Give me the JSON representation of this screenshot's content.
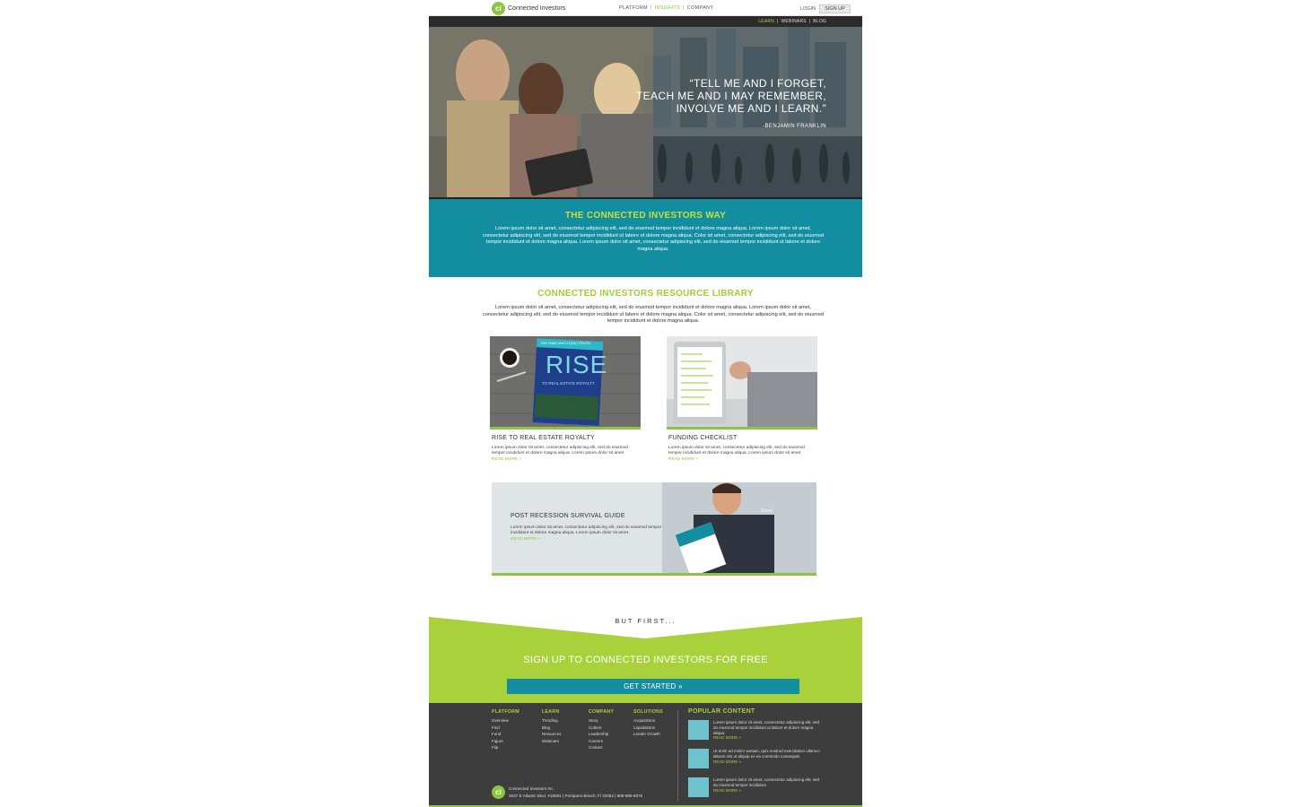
{
  "brand": {
    "name": "Connected Investors",
    "mark": "ci"
  },
  "nav": {
    "items": [
      "PLATFORM",
      "INSIGHTS",
      "COMPANY"
    ],
    "login": "LOGIN",
    "signup": "SIGN UP"
  },
  "subnav": {
    "items": [
      "LEARN",
      "WEBINARS",
      "BLOG"
    ]
  },
  "hero": {
    "quote_lines": [
      "“TELL ME AND I FORGET,",
      "TEACH ME AND I MAY REMEMBER,",
      "INVOLVE ME AND I LEARN.”"
    ],
    "attribution": "-BENJAMIN FRANKLIN"
  },
  "way": {
    "title": "THE CONNECTED INVESTORS WAY",
    "body": "Lorem ipsum dolor sit amet, consectetur adipiscing elit, sed do eiusmod tempor incididunt et dolore magna aliqua. Lorem ipsum dolor sit amet, consectetur adipiscing elit, sed do eiusmod tempor incididunt ut labore et dolore magna aliqua. Color sit amet, consectetur adipiscing elit, sed do eiusmod tempor incididunt et dolore magna aliqua. Lorem ipsum dolor sit amet, consectetur adipiscing elit, sed do eiusmod tempor incididunt ut labore et dolore magna aliqua."
  },
  "library": {
    "title": "CONNECTED INVESTORS RESOURCE LIBRARY",
    "body": "Lorem ipsum dolor sit amet, consectetur adipiscing elit, sed do eiusmod tempor incididunt et dolore magna aliqua. Lorem ipsum dolor sit amet, consectetur adipiscing elit, sed do eiusmod tempor incididunt ut labore et dolore magna aliqua. Color sit amet, consectetur adipiscing elit, sed do eiusmod tempor incididunt et dolore magna aliqua.",
    "cards": [
      {
        "title": "RISE TO REAL ESTATE ROYALTY",
        "body": "Lorem ipsum dolor sit amet, consectetur adipiscing elit, sed do eiusmod tempor incididunt et dolore magna aliqua. Lorem ipsum dolor sit amet.",
        "read_more": "READ MORE »",
        "book_word": "RISE",
        "book_sub": "TO REAL ESTATE ROYALTY",
        "book_top": "THE RAW UNCUT(ED) TRUTH"
      },
      {
        "title": "FUNDING CHECKLIST",
        "body": "Lorem ipsum dolor sit amet, consectetur adipiscing elit, sed do eiusmod tempor incididunt et dolore magna aliqua. Lorem ipsum dolor sit amet.",
        "read_more": "READ MORE »"
      }
    ],
    "wide": {
      "title": "POST RECESSION SURVIVAL GUIDE",
      "body": "Lorem ipsum dolor sit amet, consectetur adipiscing elit, sed do eiusmod tempor incididunt et dolore magna aliqua. Lorem ipsum dolor sit amet.",
      "read_more": "READ MORE »",
      "watermark": "iStock"
    }
  },
  "signup": {
    "but_first": "BUT FIRST...",
    "title": "SIGN UP TO CONNECTED INVESTORS FOR FREE",
    "cta": "GET STARTED »"
  },
  "footer": {
    "columns": [
      {
        "head": "PLATFORM",
        "items": [
          "Overview",
          "Find",
          "Fund",
          "Figure",
          "Flip"
        ]
      },
      {
        "head": "LEARN",
        "items": [
          "Trending",
          "Blog",
          "Resources",
          "Webinars"
        ]
      },
      {
        "head": "COMPANY",
        "items": [
          "Story",
          "Culture",
          "Leadership",
          "Careers",
          "Contact"
        ]
      },
      {
        "head": "SOLUTIONS",
        "items": [
          "Acquisitions",
          "Liquidations",
          "Lender Growth"
        ]
      }
    ],
    "popular_title": "POPULAR CONTENT",
    "popular": [
      {
        "text": "Lorem ipsum dolor sit amet, consectetur adipiscing elit, sed do eiusmod tempor incididunt ut labore et dolore magna aliqua.",
        "read_more": "READ MORE »"
      },
      {
        "text": "Ut enim ad minim veniam, quis nostrud exercitation ullamco laboris nisi ut aliquip ex ea commodo consequat.",
        "read_more": "READ MORE »"
      },
      {
        "text": "Lorem ipsum dolor sit amet, consectetur adipiscing elit, sed do eiusmod tempor incididunt.",
        "read_more": "READ MORE »"
      }
    ],
    "company_name": "Connected Investors Inc.",
    "address": "2637 E Atlantic Blvd. #18591  |  Pompano Beach, Fl 33062  |  888-886-8575"
  },
  "colors": {
    "teal": "#138ea0",
    "lime": "#8cc63f",
    "dark": "#3d3d3d"
  }
}
